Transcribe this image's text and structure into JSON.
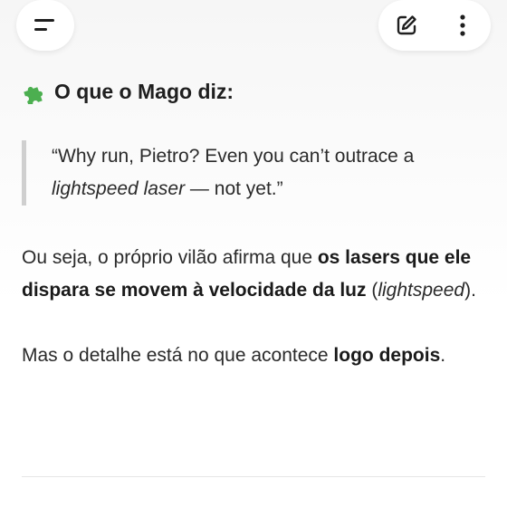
{
  "header": {
    "menu_icon": "menu-icon",
    "edit_icon": "edit-icon",
    "more_icon": "more-vertical-icon"
  },
  "message": {
    "heading_icon": "puzzle-piece-icon",
    "heading": "O que o Mago diz:",
    "quote": {
      "part1": "“Why run, Pietro? Even you can’t outrace a ",
      "italic": "lightspeed laser",
      "part2": " — not yet.”"
    },
    "paragraph1": {
      "part1": "Ou seja, o próprio vilão afirma que ",
      "bold": "os lasers que ele dispara se movem à velocidade da luz",
      "part2": " (",
      "italic": "lightspeed",
      "part3": ")."
    },
    "paragraph2": {
      "part1": "Mas o detalhe está no que acontece ",
      "bold": "logo depois",
      "part2": "."
    }
  },
  "colors": {
    "text": "#1f1f1f",
    "quote_bar": "#cfcfcf",
    "puzzle": "#4caf50"
  }
}
